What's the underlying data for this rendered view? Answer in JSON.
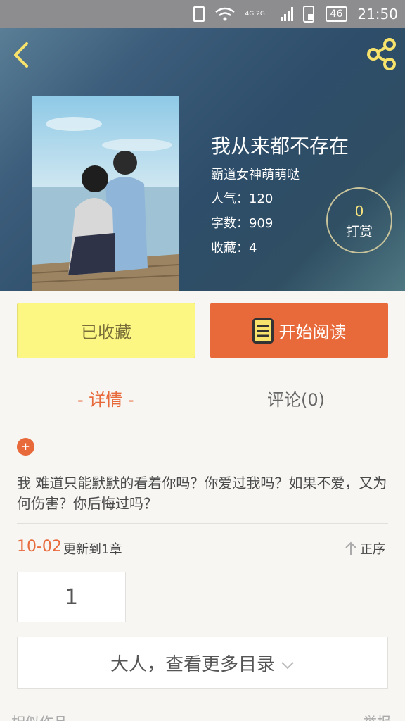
{
  "status_bar": {
    "network": "4G 2G",
    "battery": "46",
    "time": "21:50"
  },
  "book": {
    "title": "我从来都不存在",
    "author": "霸道女神萌萌哒",
    "stats": {
      "popularity": "人气：120",
      "words": "字数：909",
      "favorites": "收藏：4"
    },
    "tip": {
      "count": "0",
      "label": "打赏"
    }
  },
  "actions": {
    "collected_label": "已收藏",
    "read_label": "开始阅读"
  },
  "tabs": {
    "detail": "- 详情 -",
    "comments": "评论(0)"
  },
  "description": "我  难道只能默默的看着你吗？你爱过我吗？如果不爱，又为何伤害？你后悔过吗？",
  "update": {
    "date": "10-02",
    "text": "更新到1章",
    "order_label": "正序"
  },
  "chapters": [
    "1"
  ],
  "more_catalog_label": "大人，查看更多目录",
  "footer": {
    "left": "相似作品",
    "right": "举报"
  },
  "colors": {
    "accent": "#e8693a",
    "collected_bg": "#fcf682"
  },
  "icons": [
    "back-icon",
    "share-icon",
    "book-icon",
    "plus-icon",
    "arrow-up-icon",
    "chevron-down-icon"
  ]
}
